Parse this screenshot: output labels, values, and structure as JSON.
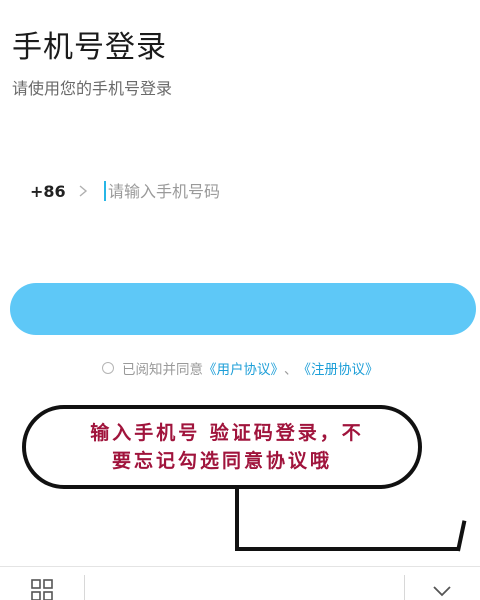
{
  "header": {
    "title": "手机号登录",
    "subtitle": "请使用您的手机号登录"
  },
  "phone": {
    "country_code": "+86",
    "placeholder": "请输入手机号码",
    "value": ""
  },
  "login_button": {
    "label": ""
  },
  "agreement": {
    "prefix": "已阅知并同意",
    "user_agreement": "《用户协议》",
    "separator": "、",
    "registration_agreement": "《注册协议》",
    "checked": false
  },
  "annotation": {
    "line1": "输入手机号 验证码登录，不",
    "line2": "要忘记勾选同意协议哦"
  },
  "colors": {
    "accent": "#5ec8f7",
    "link": "#1e9fd8",
    "annotation_text": "#a0143c"
  },
  "icons": {
    "country_selector": "chevron-right-icon",
    "bottom_left": "grid-icon",
    "bottom_right": "chevron-down-icon"
  }
}
